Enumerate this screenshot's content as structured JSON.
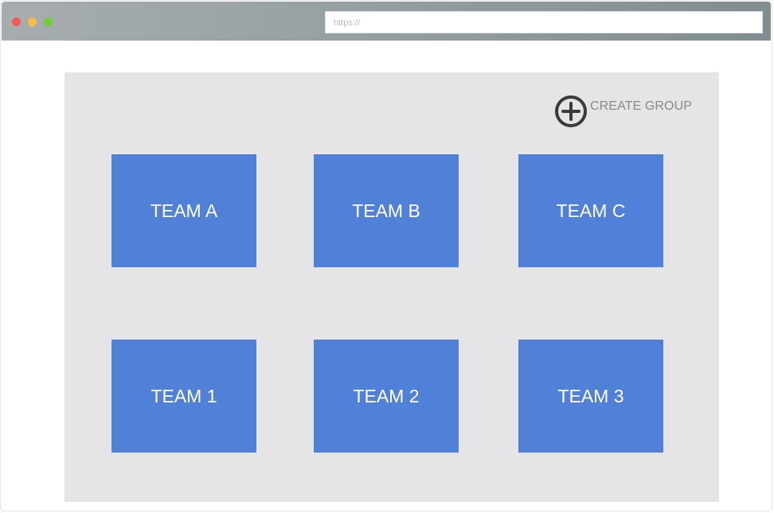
{
  "browser": {
    "address_placeholder": "https://"
  },
  "toolbar": {
    "create_group_label": "CREATE GROUP",
    "create_group_icon": "plus-circle-icon"
  },
  "teams": [
    {
      "label": "TEAM A"
    },
    {
      "label": "TEAM B"
    },
    {
      "label": "TEAM C"
    },
    {
      "label": "TEAM 1"
    },
    {
      "label": "TEAM 2"
    },
    {
      "label": "TEAM 3"
    }
  ],
  "colors": {
    "card": "#5180d8",
    "panel": "#e5e5e7",
    "icon": "#3a3a3a"
  }
}
